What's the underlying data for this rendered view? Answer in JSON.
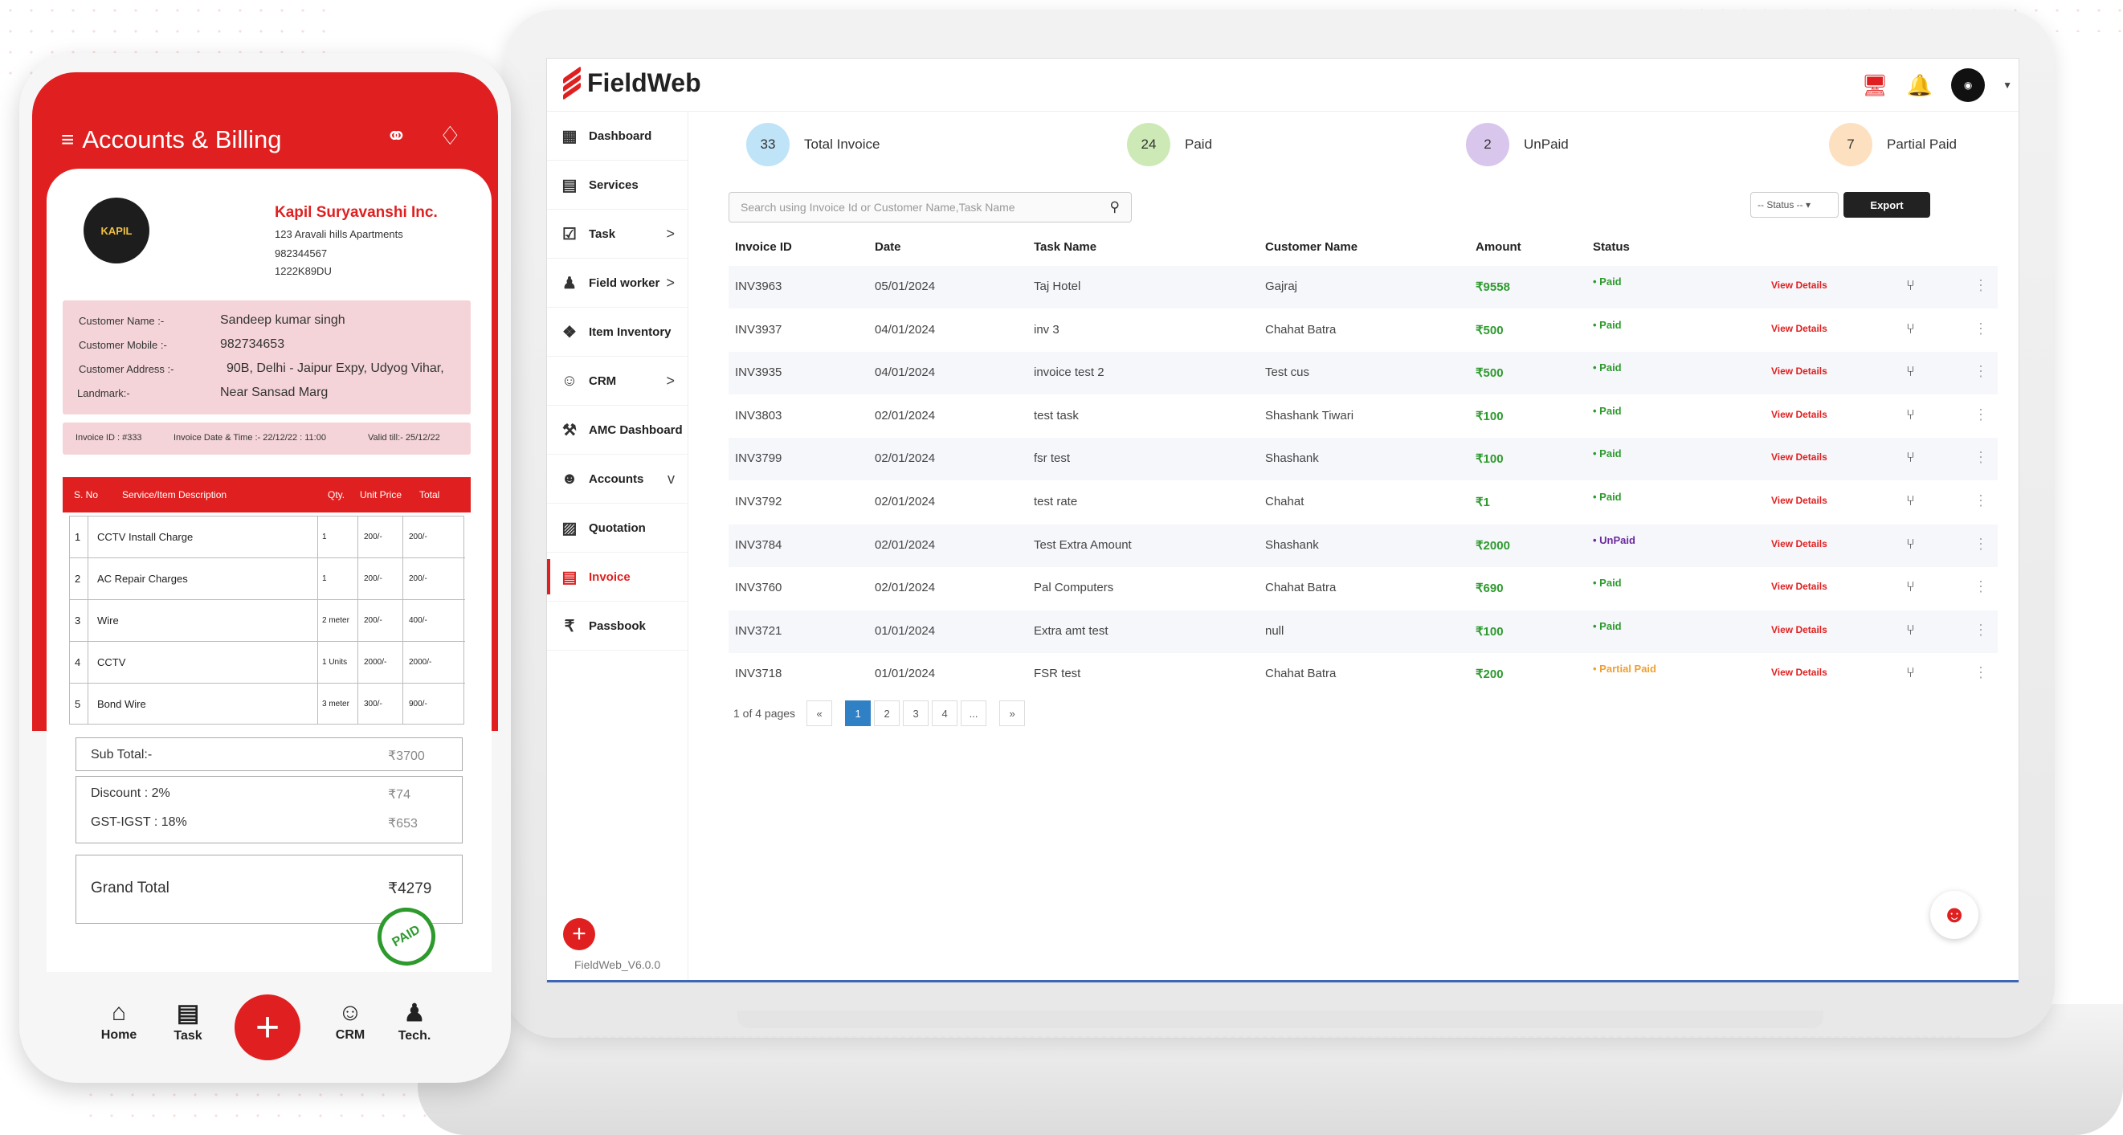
{
  "app": {
    "brand": "FieldWeb",
    "version": "FieldWeb_V6.0.0"
  },
  "sidebar": {
    "items": [
      {
        "label": "Dashboard",
        "icon": "dashboard-icon",
        "chevron": ""
      },
      {
        "label": "Services",
        "icon": "services-icon",
        "chevron": ""
      },
      {
        "label": "Task",
        "icon": "task-icon",
        "chevron": ">"
      },
      {
        "label": "Field worker",
        "icon": "field-worker-icon",
        "chevron": ">"
      },
      {
        "label": "Item Inventory",
        "icon": "inventory-icon",
        "chevron": ""
      },
      {
        "label": "CRM",
        "icon": "crm-icon",
        "chevron": ">"
      },
      {
        "label": "AMC Dashboard",
        "icon": "wrench-icon",
        "chevron": ""
      },
      {
        "label": "Accounts",
        "icon": "accounts-icon",
        "chevron": "v"
      },
      {
        "label": "Quotation",
        "icon": "quotation-icon",
        "chevron": ""
      },
      {
        "label": "Invoice",
        "icon": "invoice-icon",
        "chevron": ""
      },
      {
        "label": "Passbook",
        "icon": "rupee-icon",
        "chevron": ""
      }
    ],
    "add_label": "+"
  },
  "stats": [
    {
      "count": "33",
      "label": "Total Invoice",
      "color": "#bfe3f7"
    },
    {
      "count": "24",
      "label": "Paid",
      "color": "#cdeab6"
    },
    {
      "count": "2",
      "label": "UnPaid",
      "color": "#d9c6ec"
    },
    {
      "count": "7",
      "label": "Partial Paid",
      "color": "#fde0bf"
    }
  ],
  "search": {
    "placeholder": "Search using Invoice Id or Customer Name,Task Name"
  },
  "filters": {
    "status": "-- Status --",
    "export": "Export"
  },
  "table": {
    "headers": [
      "Invoice ID",
      "Date",
      "Task Name",
      "Customer Name",
      "Amount",
      "Status"
    ],
    "rows": [
      {
        "id": "INV3963",
        "date": "05/01/2024",
        "task": "Taj Hotel",
        "customer": "Gajraj",
        "amount": "₹9558",
        "status": "• Paid",
        "type": "paid"
      },
      {
        "id": "INV3937",
        "date": "04/01/2024",
        "task": "inv 3",
        "customer": "Chahat Batra",
        "amount": "₹500",
        "status": "• Paid",
        "type": "paid"
      },
      {
        "id": "INV3935",
        "date": "04/01/2024",
        "task": "invoice test 2",
        "customer": "Test cus",
        "amount": "₹500",
        "status": "• Paid",
        "type": "paid"
      },
      {
        "id": "INV3803",
        "date": "02/01/2024",
        "task": "test task",
        "customer": "Shashank Tiwari",
        "amount": "₹100",
        "status": "• Paid",
        "type": "paid"
      },
      {
        "id": "INV3799",
        "date": "02/01/2024",
        "task": "fsr test",
        "customer": "Shashank",
        "amount": "₹100",
        "status": "• Paid",
        "type": "paid"
      },
      {
        "id": "INV3792",
        "date": "02/01/2024",
        "task": "test rate",
        "customer": "Chahat",
        "amount": "₹1",
        "status": "• Paid",
        "type": "paid"
      },
      {
        "id": "INV3784",
        "date": "02/01/2024",
        "task": "Test Extra Amount",
        "customer": "Shashank",
        "amount": "₹2000",
        "status": "• UnPaid",
        "type": "unpaid"
      },
      {
        "id": "INV3760",
        "date": "02/01/2024",
        "task": "Pal Computers",
        "customer": "Chahat Batra",
        "amount": "₹690",
        "status": "• Paid",
        "type": "paid"
      },
      {
        "id": "INV3721",
        "date": "01/01/2024",
        "task": "Extra amt test",
        "customer": "null",
        "amount": "₹100",
        "status": "• Paid",
        "type": "paid"
      },
      {
        "id": "INV3718",
        "date": "01/01/2024",
        "task": "FSR test",
        "customer": "Chahat Batra",
        "amount": "₹200",
        "status": "• Partial Paid",
        "type": "partial"
      }
    ],
    "view_label": "View Details"
  },
  "pagination": {
    "summary": "1 of 4 pages",
    "buttons": [
      "«",
      "1",
      "2",
      "3",
      "4",
      "...",
      "»"
    ],
    "active": "1"
  },
  "phone": {
    "title": "Accounts & Billing",
    "company": {
      "logo_text": "KAPIL",
      "name": "Kapil Suryavanshi Inc.",
      "address": "123 Aravali hills Apartments",
      "phone": "982344567",
      "code": "1222K89DU"
    },
    "customer": {
      "name_label": "Customer Name :-",
      "name": "Sandeep kumar singh",
      "mobile_label": "Customer Mobile :-",
      "mobile": "982734653",
      "address_label": "Customer Address :-",
      "address": "90B, Delhi - Jaipur Expy, Udyog Vihar,",
      "landmark_label": "Landmark:-",
      "landmark": "Near Sansad Marg"
    },
    "invoice_meta": {
      "id": "Invoice ID : #333",
      "date": "Invoice Date & Time :- 22/12/22 : 11:00",
      "valid": "Valid till:- 25/12/22"
    },
    "items_headers": [
      "S. No",
      "Service/Item Description",
      "Qty.",
      "Unit Price",
      "Total"
    ],
    "items": [
      {
        "no": "1",
        "desc": "CCTV Install Charge",
        "qty": "1",
        "price": "200/-",
        "total": "200/-"
      },
      {
        "no": "2",
        "desc": "AC Repair Charges",
        "qty": "1",
        "price": "200/-",
        "total": "200/-"
      },
      {
        "no": "3",
        "desc": "Wire",
        "qty": "2 meter",
        "price": "200/-",
        "total": "400/-"
      },
      {
        "no": "4",
        "desc": "CCTV",
        "qty": "1 Units",
        "price": "2000/-",
        "total": "2000/-"
      },
      {
        "no": "5",
        "desc": "Bond Wire",
        "qty": "3 meter",
        "price": "300/-",
        "total": "900/-"
      }
    ],
    "subtotal_label": "Sub Total:-",
    "subtotal": "₹3700",
    "discount_label": "Discount : 2%",
    "discount": "₹74",
    "gst_label": "GST-IGST : 18%",
    "gst": "₹653",
    "grand_label": "Grand Total",
    "grand": "₹4279",
    "stamp": "PAID",
    "nav": [
      {
        "label": "Home",
        "icon": "home-icon"
      },
      {
        "label": "Task",
        "icon": "task-icon"
      },
      {
        "label": "CRM",
        "icon": "crm-icon"
      },
      {
        "label": "Tech.",
        "icon": "technician-icon"
      }
    ],
    "nav_add": "+"
  },
  "colors": {
    "accent": "#e02020",
    "paid": "#2e9a2e",
    "unpaid": "#6a2a9e",
    "partial": "#f0a030",
    "active_page": "#2f80c4"
  }
}
